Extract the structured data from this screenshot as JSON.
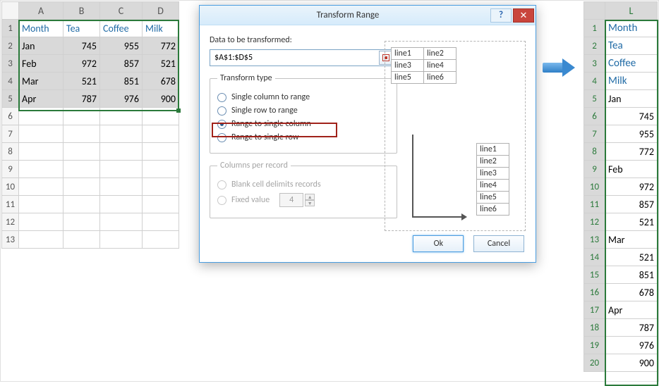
{
  "left_sheet": {
    "cols": [
      "A",
      "B",
      "C",
      "D"
    ],
    "rows": [
      "1",
      "2",
      "3",
      "4",
      "5",
      "6",
      "7",
      "8",
      "9",
      "10",
      "11",
      "12",
      "13"
    ],
    "headers": {
      "A1": "Month",
      "B1": "Tea",
      "C1": "Coffee",
      "D1": "Milk"
    },
    "data": [
      {
        "A": "Jan",
        "B": "745",
        "C": "955",
        "D": "772"
      },
      {
        "A": "Feb",
        "B": "972",
        "C": "857",
        "D": "521"
      },
      {
        "A": "Mar",
        "B": "521",
        "C": "851",
        "D": "678"
      },
      {
        "A": "Apr",
        "B": "787",
        "C": "976",
        "D": "900"
      }
    ]
  },
  "dialog": {
    "title": "Transform Range",
    "help": "?",
    "close": "✕",
    "data_label": "Data to be transformed:",
    "range": "$A$1:$D$5",
    "type_legend": "Transform type",
    "opt1": "Single column to range",
    "opt2": "Single row to range",
    "opt3": "Range to single column",
    "opt4": "Range to single row",
    "cpr_legend": "Columns per record",
    "cpr_opt1": "Blank cell delimits records",
    "cpr_opt2": "Fixed value",
    "cpr_val": "4",
    "ok": "Ok",
    "cancel": "Cancel",
    "preview_src": [
      "line1",
      "line2",
      "line3",
      "line4",
      "line5",
      "line6"
    ],
    "preview_dst": [
      "line1",
      "line2",
      "line3",
      "line4",
      "line5",
      "line6"
    ]
  },
  "right_sheet": {
    "col": "L",
    "rows": [
      "1",
      "2",
      "3",
      "4",
      "5",
      "6",
      "7",
      "8",
      "9",
      "10",
      "11",
      "12",
      "13",
      "14",
      "15",
      "16",
      "17",
      "18",
      "19",
      "20"
    ],
    "values": [
      "Month",
      "Tea",
      "Coffee",
      "Milk",
      "Jan",
      "745",
      "955",
      "772",
      "Feb",
      "972",
      "857",
      "521",
      "Mar",
      "521",
      "851",
      "678",
      "Apr",
      "787",
      "976",
      "900"
    ],
    "align": [
      "l",
      "l",
      "l",
      "l",
      "l",
      "r",
      "r",
      "r",
      "l",
      "r",
      "r",
      "r",
      "l",
      "r",
      "r",
      "r",
      "l",
      "r",
      "r",
      "r"
    ],
    "hdrlike": [
      true,
      true,
      true,
      true,
      false,
      false,
      false,
      false,
      false,
      false,
      false,
      false,
      false,
      false,
      false,
      false,
      false,
      false,
      false,
      false
    ]
  }
}
